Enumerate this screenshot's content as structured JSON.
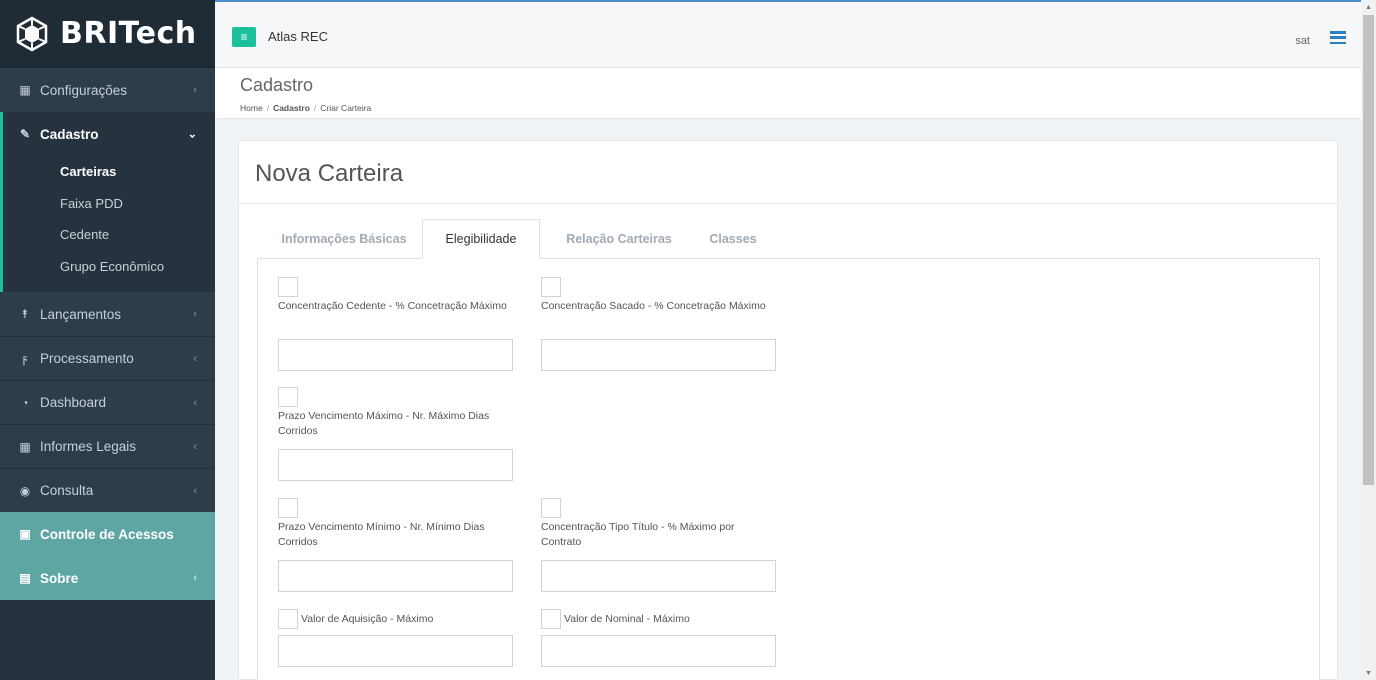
{
  "brand": {
    "name": "BRITech"
  },
  "sidebar": {
    "items": [
      {
        "label": "Configurações",
        "icon": "grid-icon"
      },
      {
        "label": "Cadastro",
        "icon": "edit-icon"
      },
      {
        "label": "Lançamentos",
        "icon": "upload-icon"
      },
      {
        "label": "Processamento",
        "icon": "bolt-icon"
      },
      {
        "label": "Dashboard",
        "icon": "pie-chart-icon"
      },
      {
        "label": "Informes Legais",
        "icon": "building-icon"
      },
      {
        "label": "Consulta",
        "icon": "binoculars-icon"
      },
      {
        "label": "Controle de Acessos",
        "icon": "lock-icon"
      },
      {
        "label": "Sobre",
        "icon": "book-icon"
      }
    ],
    "subitems": [
      "Carteiras",
      "Faixa PDD",
      "Cedente",
      "Grupo Econômico"
    ]
  },
  "topbar": {
    "app_title": "Atlas REC",
    "user": "sat"
  },
  "header": {
    "title": "Cadastro",
    "breadcrumb": [
      "Home",
      "Cadastro",
      "Criar Carteira"
    ]
  },
  "card": {
    "title": "Nova Carteira",
    "tabs": [
      "Informações Básicas",
      "Elegibilidade",
      "Relação Carteiras",
      "Classes"
    ],
    "active_tab": "Elegibilidade"
  },
  "form": {
    "f1": {
      "label": "Concentração Cedente - % Concetração Máximo",
      "value": ""
    },
    "f2": {
      "label": "Concentração Sacado - % Concetração Máximo",
      "value": ""
    },
    "f3": {
      "label": "Prazo Vencimento Máximo - Nr. Máximo Dias Corridos",
      "value": ""
    },
    "f4": {
      "label": "Prazo Vencimento Mínimo - Nr. Mínimo Dias Corridos",
      "value": ""
    },
    "f5": {
      "label": "Concentração Tipo Título - % Máximo por Contrato",
      "value": ""
    },
    "f6": {
      "label": "Valor de Aquisição - Máximo",
      "value": ""
    },
    "f7": {
      "label": "Valor de Nominal - Máximo",
      "value": ""
    }
  },
  "colors": {
    "accent": "#1cc09a",
    "sidebar": "#26333f",
    "teal_item": "#5ea6a4",
    "link_blue": "#2d7fc1"
  }
}
